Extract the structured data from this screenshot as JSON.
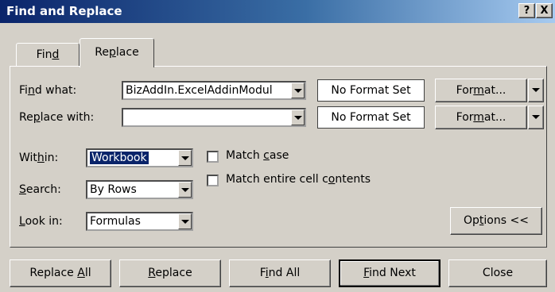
{
  "window": {
    "title": "Find and Replace"
  },
  "title_buttons": {
    "help": "?",
    "close": "X"
  },
  "tabs": [
    {
      "label": "Find",
      "accel": "d"
    },
    {
      "label": "Replace",
      "accel": "p",
      "active": true
    }
  ],
  "find_what": {
    "label": "Find what:",
    "value": "BizAddIn.ExcelAddinModul",
    "format": "No Format Set",
    "format_button": "Format..."
  },
  "replace_with": {
    "label": "Replace with:",
    "value": "",
    "format": "No Format Set",
    "format_button": "Format..."
  },
  "within": {
    "label": "Within:",
    "value": "Workbook"
  },
  "search": {
    "label": "Search:",
    "value": "By Rows"
  },
  "look_in": {
    "label": "Look in:",
    "value": "Formulas"
  },
  "match_case": {
    "label": "Match case",
    "checked": false
  },
  "match_entire": {
    "label": "Match entire cell contents",
    "checked": false
  },
  "options_button": "Options <<",
  "buttons": {
    "replace_all": "Replace All",
    "replace": "Replace",
    "find_all": "Find All",
    "find_next": "Find Next",
    "close": "Close"
  }
}
